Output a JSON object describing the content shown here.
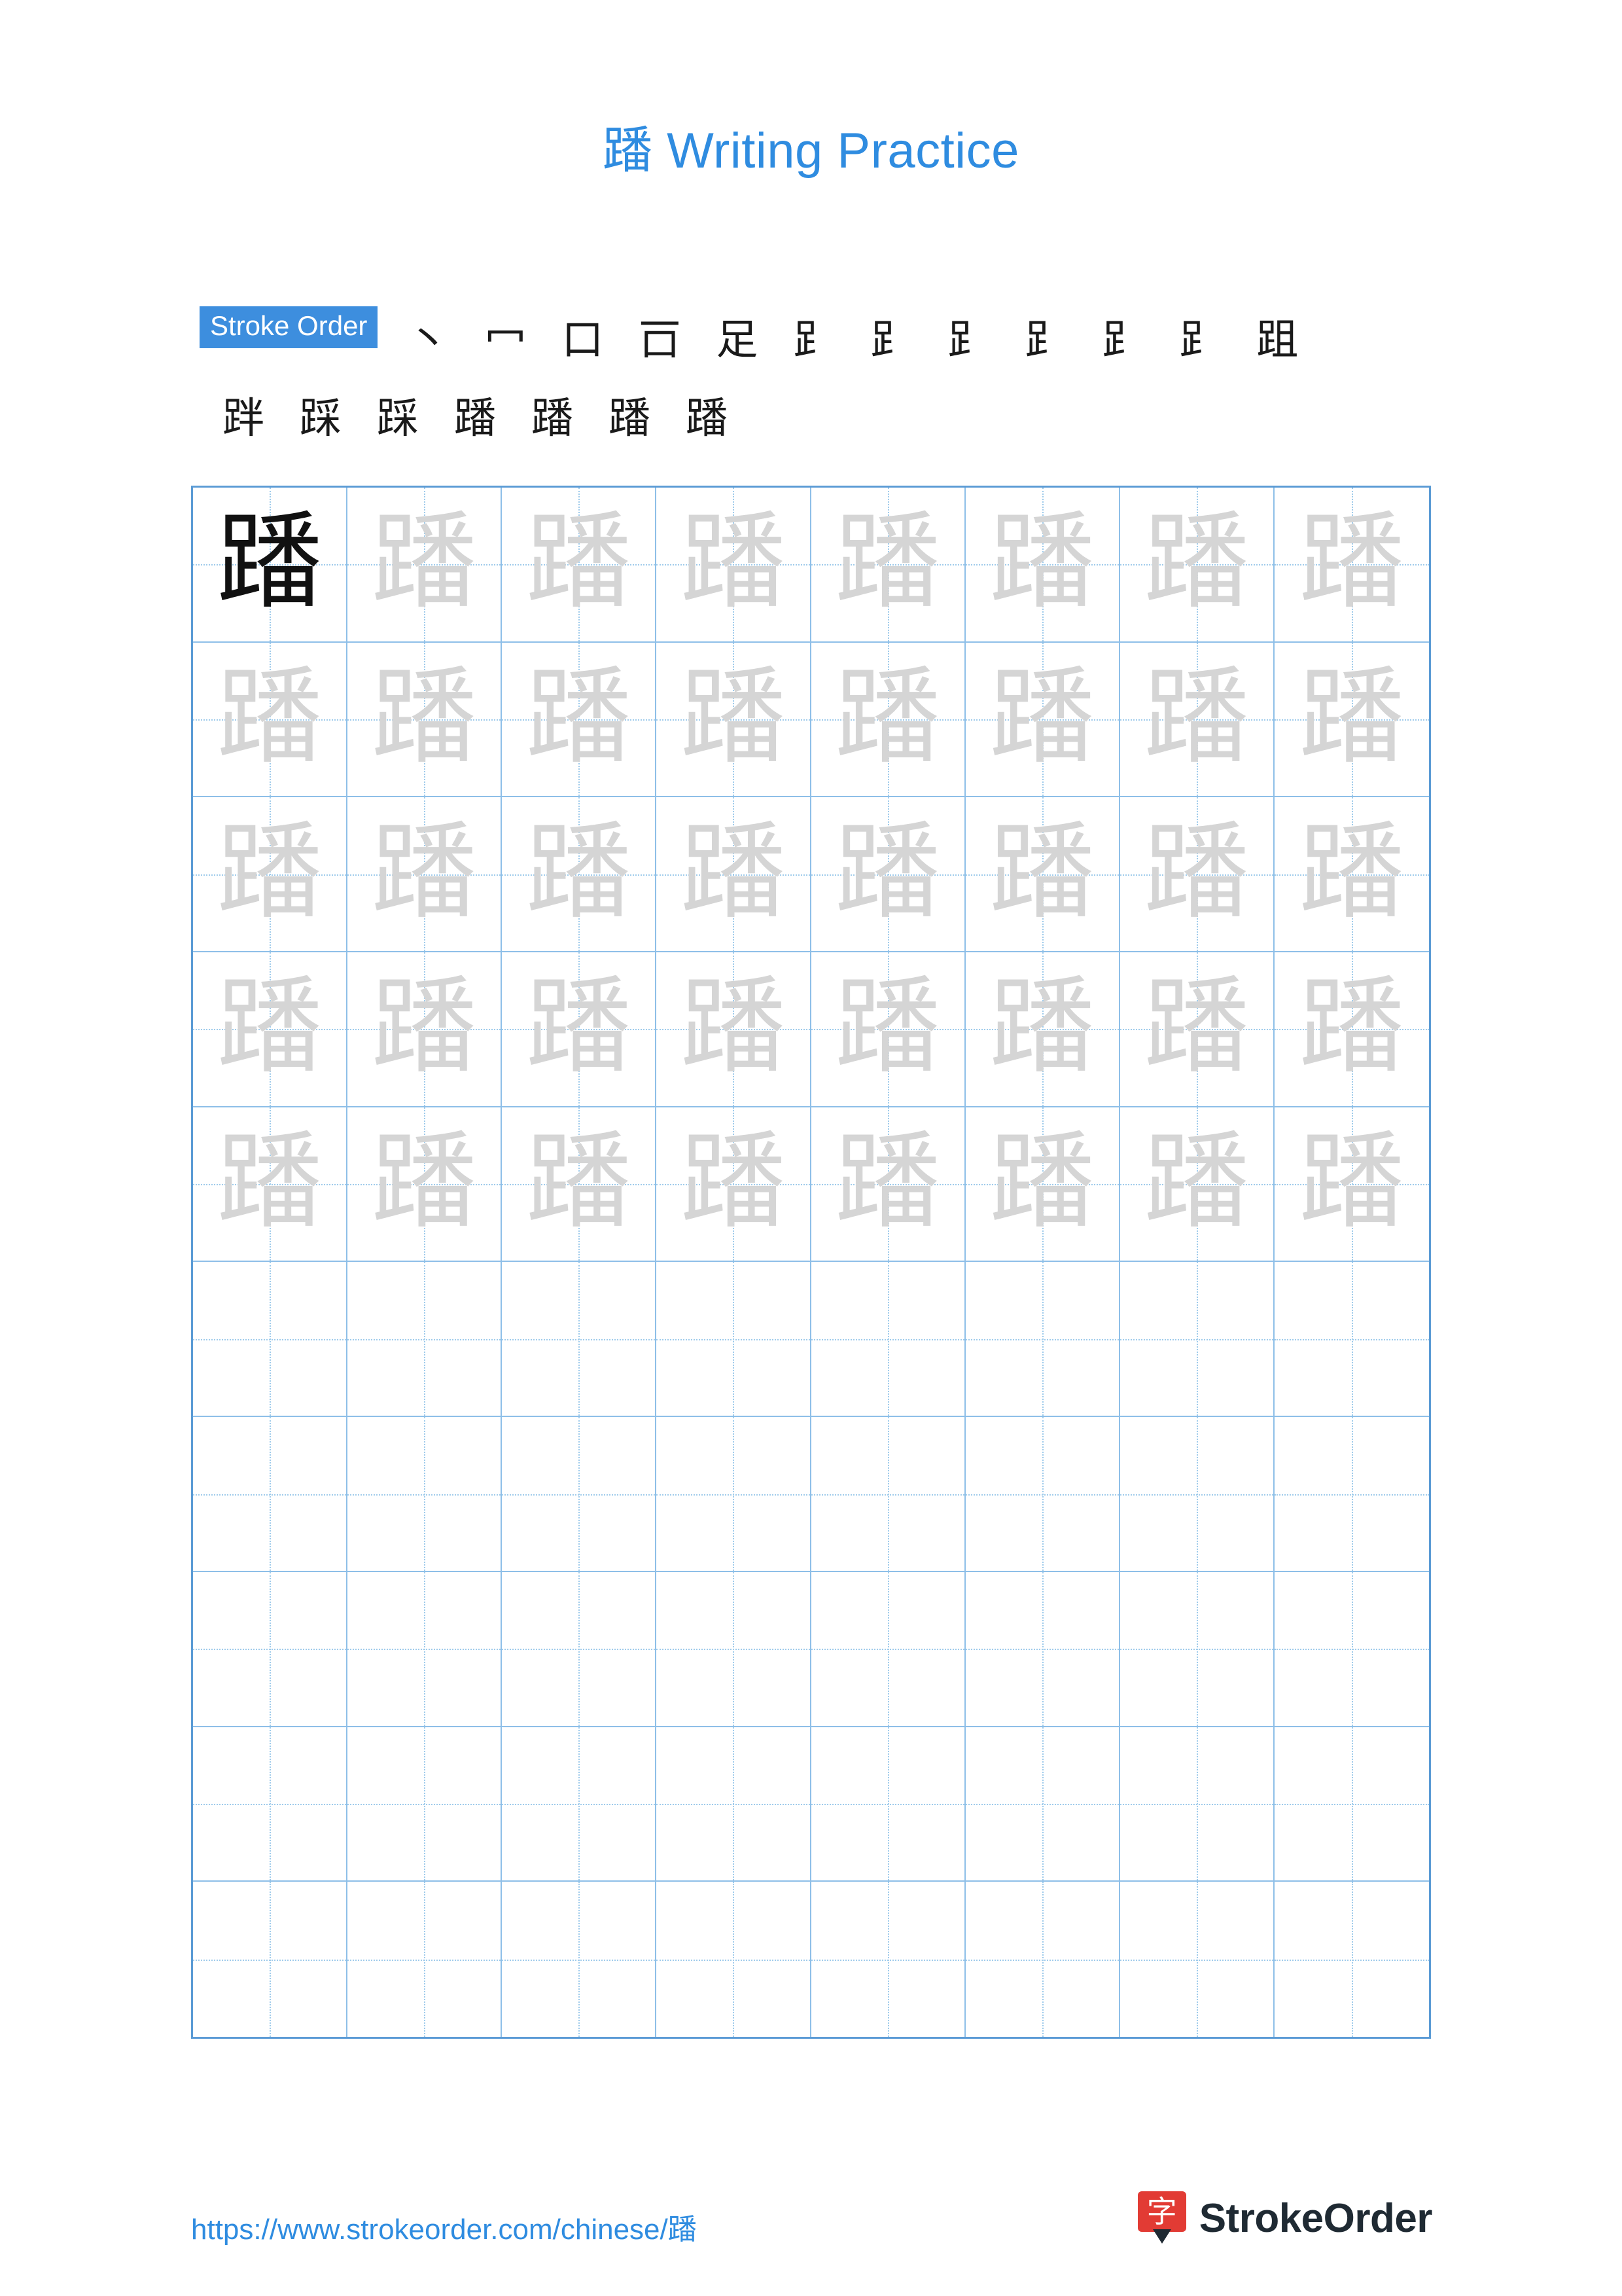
{
  "document": {
    "character": "蹯",
    "title_prefix": "蹯",
    "title_suffix": " Writing Practice",
    "accent_color": "#2f8ce0",
    "grid_color": "#5b9bd5"
  },
  "stroke_order": {
    "label": "Stroke Order",
    "steps_row1": [
      "丶",
      "冖",
      "口",
      "𠮛",
      "足",
      "𧾷",
      "𧾷",
      "𧾷",
      "𧾷",
      "𧾷",
      "𧾷",
      "跙"
    ],
    "steps_row2": [
      "跘",
      "踩",
      "踩",
      "蹯",
      "蹯",
      "蹯",
      "蹯"
    ],
    "total_strokes": 19
  },
  "practice_grid": {
    "columns": 8,
    "rows": 10,
    "solid_cells": 1,
    "faint_rows": 5,
    "empty_rows": 5,
    "character": "蹯"
  },
  "footer": {
    "url_text_prefix": "https://www.strokeorder.com/chinese/",
    "url_text_character": "蹯",
    "brand_name": "StrokeOrder",
    "brand_logo_glyph": "字"
  }
}
